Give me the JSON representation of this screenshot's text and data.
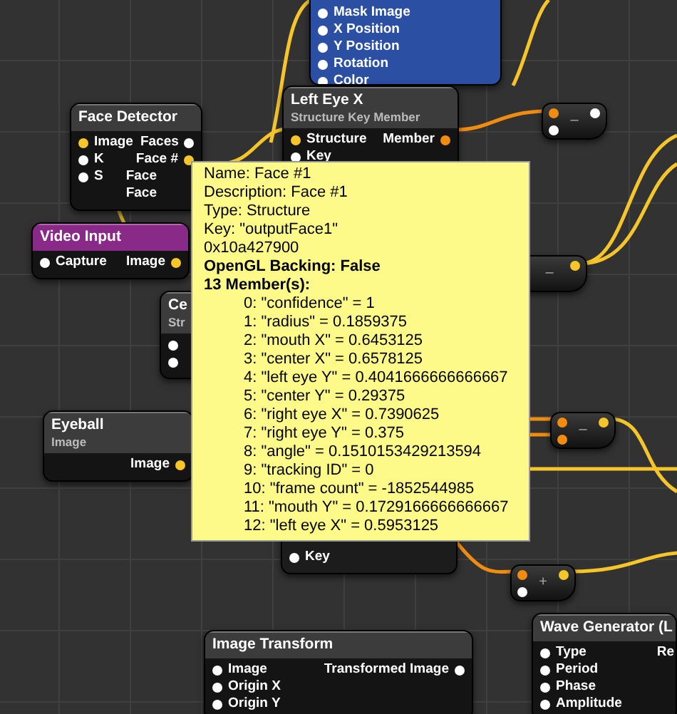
{
  "nodes": [
    {
      "kind": "patch",
      "color": "#2a4fa3",
      "inputs": [
        {
          "label": "Mask Image",
          "color": "#ffffff"
        },
        {
          "label": "X Position",
          "color": "#ffffff"
        },
        {
          "label": "Y Position",
          "color": "#ffffff"
        },
        {
          "label": "Rotation",
          "color": "#ffffff"
        },
        {
          "label": "Color",
          "color": "#ffffff"
        }
      ]
    },
    {
      "kind": "patch",
      "title": "Face Detector",
      "color": "#3c3c3c",
      "inputs": [
        {
          "label": "Image",
          "color": "#f5c52a"
        },
        {
          "label": "K",
          "color": "#ffffff"
        },
        {
          "label": "S",
          "color": "#ffffff"
        }
      ],
      "outputs": [
        {
          "label": "Faces",
          "color": "#ffffff"
        },
        {
          "label": "Face #",
          "color": "#f5c52a"
        },
        {
          "label": "Face"
        },
        {
          "label": "Face"
        }
      ]
    },
    {
      "kind": "patch",
      "title": "Left Eye X",
      "subtitle": "Structure Key Member",
      "color": "#3c3c3c",
      "inputs": [
        {
          "label": "Structure",
          "color": "#f5c52a"
        },
        {
          "label": "Key",
          "color": "#ffffff"
        }
      ],
      "outputs": [
        {
          "label": "Member",
          "color": "#f08c10"
        }
      ]
    },
    {
      "kind": "patch",
      "title": "Video Input",
      "color": "#8a2a88",
      "inputs": [
        {
          "label": "Capture",
          "color": "#ffffff"
        }
      ],
      "outputs": [
        {
          "label": "Image",
          "color": "#f5c52a"
        }
      ]
    },
    {
      "kind": "patch",
      "title": "Ce",
      "subtitle": "Str",
      "color": "#3c3c3c",
      "inputs": [
        {
          "color": "#ffffff"
        },
        {
          "color": "#ffffff"
        }
      ]
    },
    {
      "kind": "patch",
      "title": "Eyeball",
      "subtitle": "Image",
      "color": "#3c3c3c",
      "outputs": [
        {
          "label": "Image",
          "color": "#f5c52a"
        }
      ]
    },
    {
      "kind": "patch",
      "color": "#1c1c1c",
      "inputs": [
        {
          "label": "Key",
          "color": "#ffffff"
        }
      ]
    },
    {
      "kind": "patch",
      "title": "Image Transform",
      "color": "#3c3c3c",
      "inputs": [
        {
          "label": "Image",
          "color": "#ffffff"
        },
        {
          "label": "Origin X",
          "color": "#ffffff"
        },
        {
          "label": "Origin Y",
          "color": "#ffffff"
        }
      ],
      "outputs": [
        {
          "label": "Transformed Image",
          "color": "#ffffff"
        }
      ]
    },
    {
      "kind": "patch",
      "title": "Wave Generator (L",
      "color": "#3c3c3c",
      "inputs": [
        {
          "label": "Type",
          "color": "#ffffff"
        },
        {
          "label": "Period",
          "color": "#ffffff"
        },
        {
          "label": "Phase",
          "color": "#ffffff"
        },
        {
          "label": "Amplitude",
          "color": "#ffffff"
        }
      ],
      "outputs": [
        {
          "label": "Re"
        }
      ]
    },
    {
      "kind": "operator",
      "symbol": "–",
      "inputs": [
        {
          "color": "#f08c10"
        },
        {
          "color": "#ffffff"
        }
      ],
      "outputs": [
        {
          "color": "#ffffff"
        }
      ]
    },
    {
      "kind": "operator",
      "symbol": "–",
      "outputs": [
        {
          "color": "#f5c52a"
        }
      ]
    },
    {
      "kind": "operator",
      "symbol": "–",
      "inputs": [
        {
          "color": "#f08c10"
        },
        {
          "color": "#f08c10"
        }
      ],
      "outputs": [
        {
          "color": "#f5c52a"
        }
      ]
    },
    {
      "kind": "operator",
      "symbol": "+",
      "inputs": [
        {
          "color": "#f08c10"
        },
        {
          "color": "#ffffff"
        }
      ],
      "outputs": [
        {
          "color": "#f5c52a"
        }
      ]
    }
  ],
  "tooltip": {
    "lines": [
      "Name: Face #1",
      "Description: Face #1",
      "Type: Structure",
      "Key: \"outputFace1\"",
      "0x10a427900"
    ],
    "backing": "OpenGL Backing: False",
    "members_title": "13 Member(s):",
    "members": [
      "0: \"confidence\" = 1",
      "1: \"radius\" = 0.1859375",
      "2: \"mouth X\" = 0.6453125",
      "3: \"center X\" = 0.6578125",
      "4: \"left eye Y\" = 0.4041666666666667",
      "5: \"center Y\" = 0.29375",
      "6: \"right eye X\" = 0.7390625",
      "7: \"right eye Y\" = 0.375",
      "8: \"angle\" = 0.1510153429213594",
      "9: \"tracking ID\" = 0",
      "10: \"frame count\" = -1852544985",
      "11: \"mouth Y\" = 0.1729166666666667",
      "12: \"left eye X\" = 0.5953125"
    ]
  }
}
